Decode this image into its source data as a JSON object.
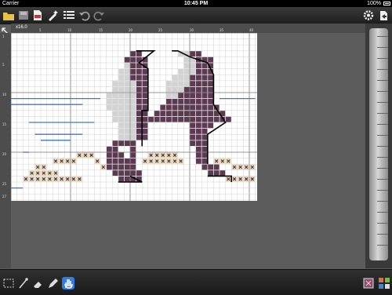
{
  "status": {
    "carrier": "Carrier",
    "time": "10:45 PM",
    "battery": "100%"
  },
  "toolbar": {
    "left_icons": [
      "folder-icon",
      "save-icon",
      "pdf-icon",
      "wand-icon",
      "list-icon",
      "undo-icon",
      "redo-icon"
    ],
    "right_icons": [
      "settings-gear-icon",
      "share-icon"
    ]
  },
  "ruler": {
    "zoom": "x16.0",
    "top_labels": [
      "1",
      "5",
      "10",
      "15",
      "20",
      "25",
      "30",
      "35",
      "40"
    ],
    "left_labels": [
      "1",
      "5",
      "10",
      "15",
      "20",
      "25",
      "27"
    ]
  },
  "bottom_tools": {
    "left": [
      "select-rect-icon",
      "needle-icon",
      "eraser-icon",
      "pen-icon",
      "hand-icon"
    ],
    "active": "hand-icon",
    "right": [
      "color-swatch-icon",
      "palette-grid-icon"
    ]
  },
  "colors": {
    "purple": "#5b3a52",
    "light_gray": "#d2d2d2",
    "tan": "#e8d6bc",
    "cross": "#3a2a2a",
    "accent_blue": "#2f7de6"
  }
}
